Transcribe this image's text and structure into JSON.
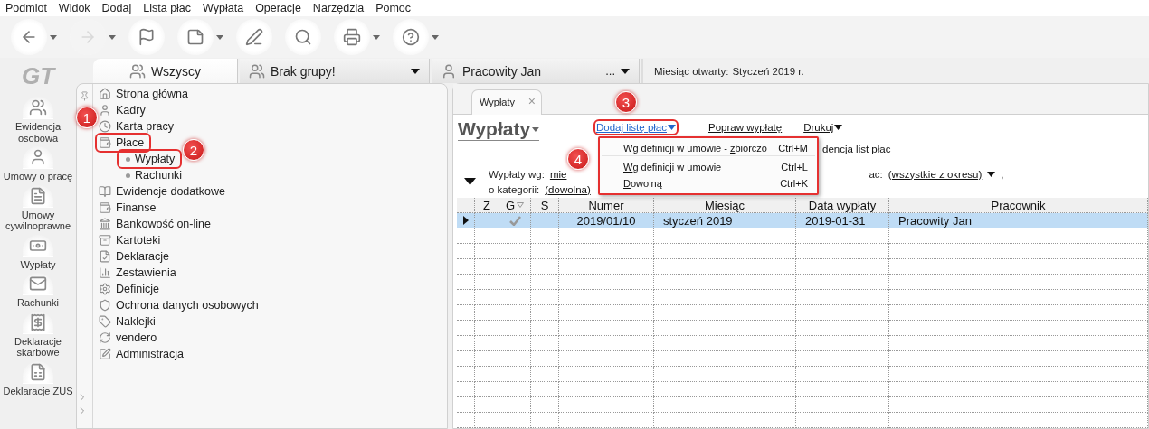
{
  "menubar": [
    "Podmiot",
    "Widok",
    "Dodaj",
    "Lista płac",
    "Wypłata",
    "Operacje",
    "Narzędzia",
    "Pomoc"
  ],
  "toolbar": [
    {
      "dropdown": true,
      "disabled": false
    },
    {
      "dropdown": true,
      "disabled": true
    },
    {
      "dropdown": false,
      "disabled": false
    },
    {
      "dropdown": true,
      "disabled": false
    },
    {
      "dropdown": false,
      "disabled": false
    },
    {
      "dropdown": false,
      "disabled": false
    },
    {
      "dropdown": true,
      "disabled": false
    },
    {
      "dropdown": true,
      "disabled": false
    }
  ],
  "logo": "GT",
  "nav": [
    "Ewidencja osobowa",
    "Umowy o pracę",
    "Umowy cywilnoprawne",
    "Wypłaty",
    "Rachunki",
    "Deklaracje skarbowe",
    "Deklaracje ZUS"
  ],
  "top_tabs": [
    {
      "label": "Wszyscy",
      "selected": true,
      "dropdown": false
    },
    {
      "label": "Brak grupy!",
      "selected": false,
      "dropdown": true
    },
    {
      "label": "Pracowity Jan",
      "selected": false,
      "dropdown": true,
      "more": "..."
    }
  ],
  "open_month": {
    "label": "Miesiąc otwarty:",
    "value": "Styczeń 2019 r."
  },
  "tree": [
    {
      "label": "Strona główna",
      "highlighted": false
    },
    {
      "label": "Kadry",
      "highlighted": false
    },
    {
      "label": "Karta pracy",
      "highlighted": false
    },
    {
      "label": "Płace",
      "highlighted": true,
      "children": [
        {
          "label": "Wypłaty",
          "highlighted": true
        },
        {
          "label": "Rachunki",
          "highlighted": false
        }
      ]
    },
    {
      "label": "Ewidencje dodatkowe",
      "highlighted": false
    },
    {
      "label": "Finanse",
      "highlighted": false
    },
    {
      "label": "Bankowość on-line",
      "highlighted": false
    },
    {
      "label": "Kartoteki",
      "highlighted": false
    },
    {
      "label": "Deklaracje",
      "highlighted": false
    },
    {
      "label": "Zestawienia",
      "highlighted": false
    },
    {
      "label": "Definicje",
      "highlighted": false
    },
    {
      "label": "Ochrona danych osobowych",
      "highlighted": false
    },
    {
      "label": "Naklejki",
      "highlighted": false
    },
    {
      "label": "vendero",
      "highlighted": false
    },
    {
      "label": "Administracja",
      "highlighted": false
    }
  ],
  "doc_tab": {
    "label": "Wypłaty",
    "close": "×"
  },
  "page_title": "Wypłaty",
  "actions": [
    {
      "label": "Dodaj listę płac",
      "dropdown": true,
      "highlighted": true
    },
    {
      "label": "Popraw wypłatę",
      "dropdown": false,
      "highlighted": false
    },
    {
      "label": "Drukuj",
      "dropdown": true,
      "highlighted": false
    }
  ],
  "second_link": "dencja list płac",
  "filters": {
    "by_label": "Wypłaty wg:",
    "by_value": "mie",
    "lists_label": "ac:",
    "lists_value": "(wszystkie z okresu)",
    "lists_suffix": ",",
    "category_label": "o kategorii:",
    "category_value": "(dowolna)"
  },
  "menu": {
    "highlighted": true,
    "items": [
      {
        "before": "Wg definicji w umowie - ",
        "key": "z",
        "after": "biorczo",
        "shortcut": "Ctrl+M"
      },
      {
        "key": "W",
        "after": "g definicji w umowie",
        "shortcut": "Ctrl+L"
      },
      {
        "key": "D",
        "after": "owolną",
        "shortcut": "Ctrl+K"
      }
    ]
  },
  "table": {
    "columns": [
      "Z",
      "G",
      "S",
      "Numer",
      "Miesiąc",
      "Data wypłaty",
      "Pracownik"
    ],
    "rows": [
      {
        "selected": true,
        "g_checked": true,
        "numer": "2019/01/10",
        "miesiac": "styczeń 2019",
        "data": "2019-01-31",
        "pracownik": "Pracowity Jan"
      }
    ]
  },
  "annotations": [
    "1",
    "2",
    "3",
    "4"
  ]
}
